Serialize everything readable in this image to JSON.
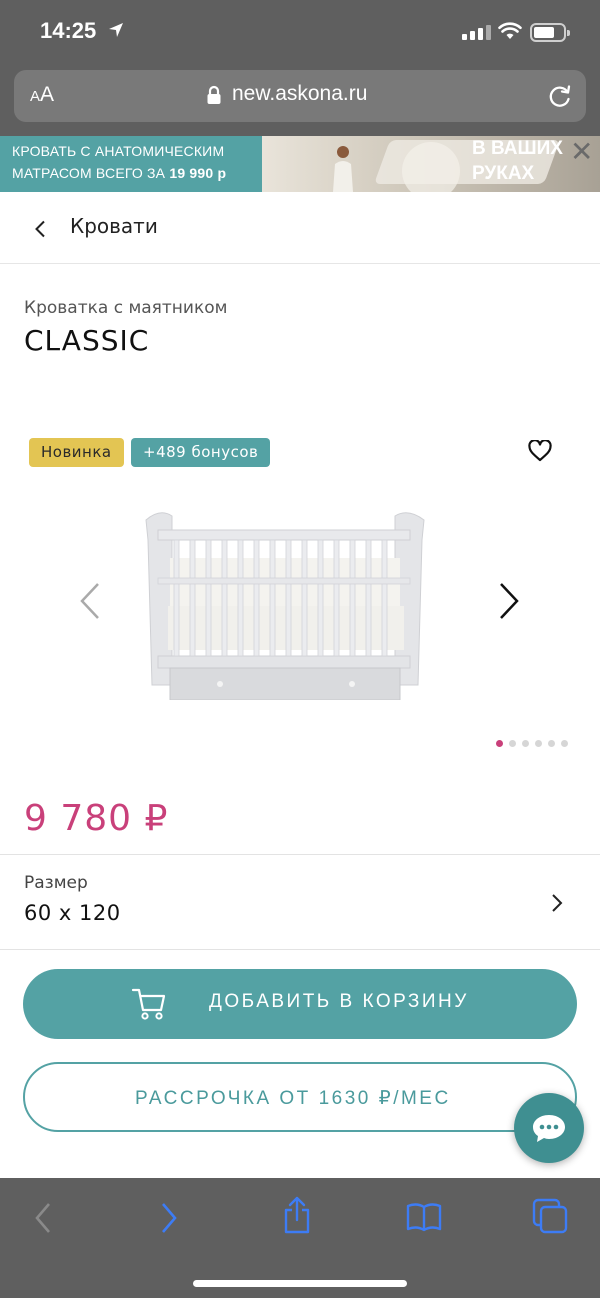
{
  "status": {
    "time": "14:25"
  },
  "browser": {
    "text_size_small": "A",
    "text_size_big": "A",
    "domain": "new.askona.ru"
  },
  "banner": {
    "line1": "КРОВАТЬ С АНАТОМИЧЕСКИМ",
    "line2_prefix": "МАТРАСОМ ВСЕГО ЗА",
    "line2_price": "19 990 р",
    "right_line1": "В ВАШИХ",
    "right_line2": "РУКАХ",
    "close": "✕"
  },
  "breadcrumb": {
    "label": "Кровати"
  },
  "product": {
    "subtitle": "Кроватка с маятником",
    "title": "CLASSIC",
    "badges": [
      "Новинка",
      "+489 бонусов"
    ],
    "price": "9 780 ₽",
    "gallery": {
      "slides": 6,
      "active_slide": 1
    }
  },
  "size": {
    "label": "Размер",
    "value": "60 x 120"
  },
  "actions": {
    "add_to_cart": "ДОБАВИТЬ В КОРЗИНУ",
    "installment": "РАССРОЧКА ОТ 1630 ₽/МЕС"
  },
  "colors": {
    "accent": "#54a2a4",
    "price": "#c9407a",
    "badge_new": "#e3c553",
    "chrome": "#5f5f5f",
    "toolbar_active": "#3d7cf5"
  }
}
